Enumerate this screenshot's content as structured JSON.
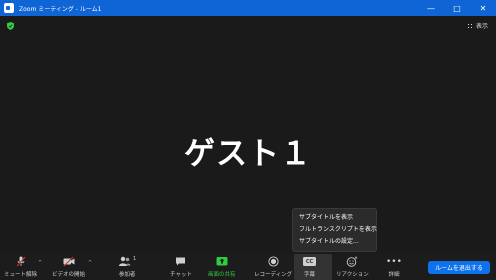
{
  "window": {
    "title": "Zoom ミーティング - ルーム1",
    "minimize": "—",
    "maximize": "□",
    "close": "✕"
  },
  "meeting": {
    "view_label": "表示",
    "participant_name": "ゲスト１"
  },
  "popup": {
    "items": [
      "サブタイトルを表示",
      "フルトランスクリプトを表示",
      "サブタイトルの設定..."
    ]
  },
  "toolbar": {
    "unmute": "ミュート解除",
    "start_video": "ビデオの開始",
    "participants": "参加者",
    "participants_count": "1",
    "chat": "チャット",
    "share": "画面の共有",
    "record": "レコーディング",
    "cc": "字幕",
    "cc_badge": "CC",
    "reactions": "リアクション",
    "more": "詳細",
    "end": "ルームを退出する"
  },
  "colors": {
    "titlebar": "#0f65d6",
    "share_green": "#2ecc40",
    "end_button": "#0e72ed",
    "security_green": "#2ecc40",
    "mic_muted_red": "#d33333"
  }
}
